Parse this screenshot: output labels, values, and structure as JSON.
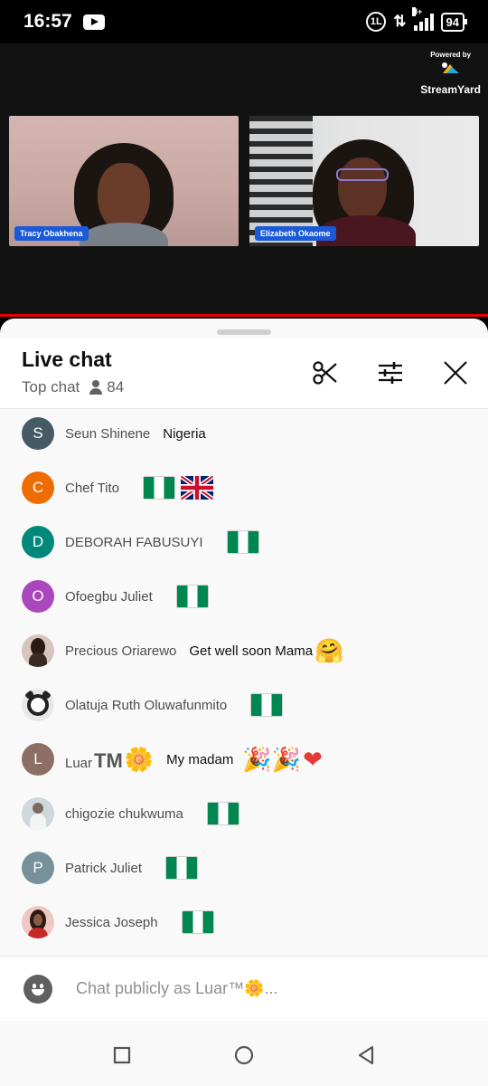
{
  "status": {
    "time": "16:57",
    "data_badge": "1L",
    "net_type": "H+",
    "battery": "94"
  },
  "video": {
    "powered_by": "Powered by",
    "brand": "StreamYard",
    "participants": [
      "Tracy Obakhena",
      "Elizabeth Okaome"
    ]
  },
  "chat": {
    "title": "Live chat",
    "mode": "Top chat",
    "viewer_count": "84",
    "messages": [
      {
        "author": "Seun Shinene",
        "text": "Nigeria",
        "initial": "S",
        "color": "#455a64"
      },
      {
        "author": "Chef Tito",
        "text": "",
        "initial": "C",
        "color": "#ef6c00"
      },
      {
        "author": "DEBORAH FABUSUYI",
        "text": "",
        "initial": "D",
        "color": "#00897b"
      },
      {
        "author": "Ofoegbu Juliet",
        "text": "",
        "initial": "O",
        "color": "#ab47bc"
      },
      {
        "author": "Precious Oriarewo",
        "text": "Get well soon Mama",
        "initial": "",
        "color": "#d9c4bd"
      },
      {
        "author": "Olatuja Ruth Oluwafunmito",
        "text": "",
        "initial": "",
        "color": "#dddddd"
      },
      {
        "author": "Luar",
        "author_tm": "TM",
        "text": "My madam",
        "initial": "L",
        "color": "#8d6e63"
      },
      {
        "author": "chigozie chukwuma",
        "text": "",
        "initial": "",
        "color": "#cfd8dc"
      },
      {
        "author": "Patrick Juliet",
        "text": "",
        "initial": "P",
        "color": "#78909c"
      },
      {
        "author": "Jessica Joseph",
        "text": "",
        "initial": "",
        "color": "#f0c7c3"
      }
    ],
    "input_placeholder": "Chat publicly as Luar™🌼..."
  }
}
